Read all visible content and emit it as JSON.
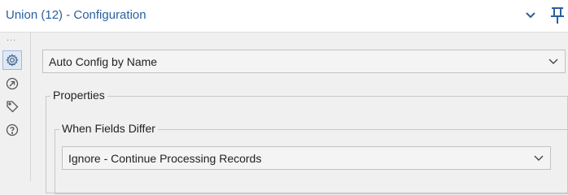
{
  "header": {
    "title": "Union (12) - Configuration",
    "accent_color": "#2b5f9e"
  },
  "rail": {
    "more_glyph": "...",
    "icons": [
      "gear-icon",
      "arrow-circle-icon",
      "tag-icon",
      "help-icon"
    ]
  },
  "config_mode": {
    "selected": "Auto Config by Name"
  },
  "properties": {
    "legend": "Properties",
    "when_fields_differ": {
      "legend": "When Fields Differ",
      "selected": "Ignore - Continue Processing Records"
    }
  }
}
